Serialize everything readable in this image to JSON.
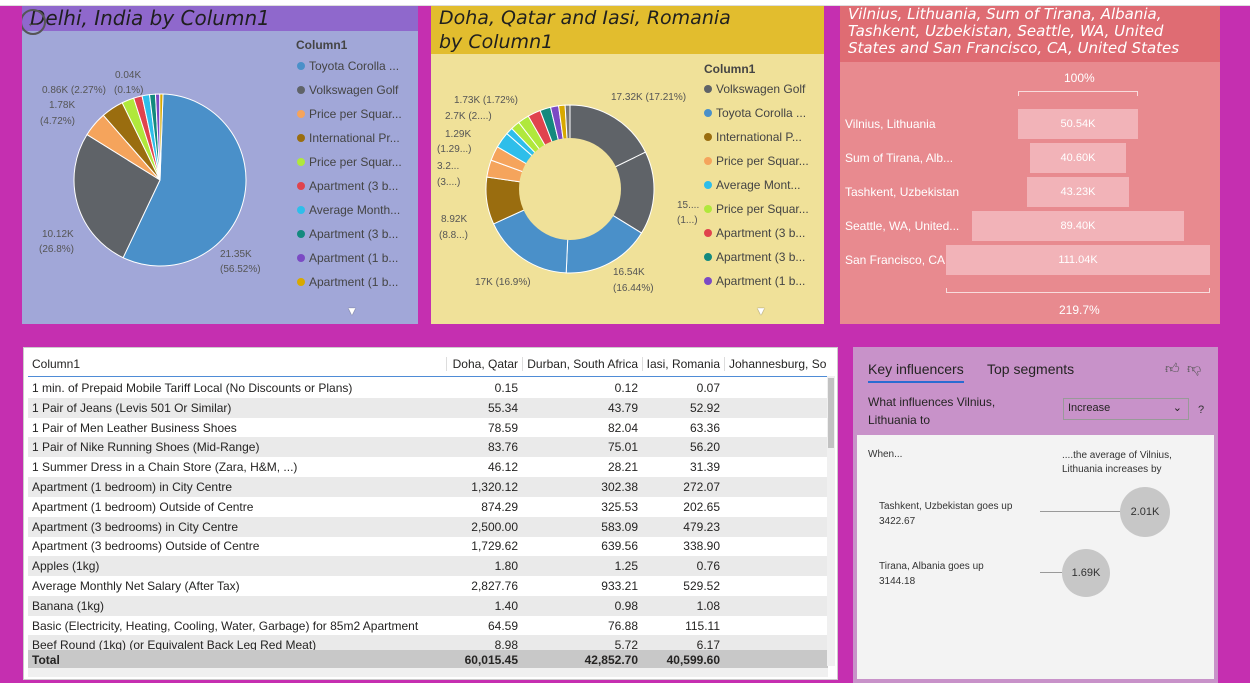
{
  "panel1": {
    "title": "Delhi, India by Column1",
    "legend_title": "Column1",
    "legend": [
      {
        "label": "Toyota Corolla ...",
        "color": "#4a90c9"
      },
      {
        "label": "Volkswagen Golf",
        "color": "#5f6368"
      },
      {
        "label": "Price per Squar...",
        "color": "#f5a45c"
      },
      {
        "label": "International Pr...",
        "color": "#9a6d0f"
      },
      {
        "label": "Price per Squar...",
        "color": "#b0e83c"
      },
      {
        "label": "Apartment (3 b...",
        "color": "#e0434d"
      },
      {
        "label": "Average Month...",
        "color": "#2ebeea"
      },
      {
        "label": "Apartment (3 b...",
        "color": "#138a7e"
      },
      {
        "label": "Apartment (1 b...",
        "color": "#7b4ac4"
      },
      {
        "label": "Apartment (1 b...",
        "color": "#d8a900"
      }
    ],
    "labels": {
      "a": "0.04K",
      "b": "0.86K (2.27%)",
      "c": "(0.1%)",
      "d": "1.78K",
      "e": "(4.72%)",
      "f": "10.12K",
      "g": "(26.8%)",
      "h": "21.35K",
      "i": "(56.52%)"
    }
  },
  "panel2": {
    "title": "Doha, Qatar and Iasi, Romania by Column1",
    "legend_title": "Column1",
    "legend": [
      {
        "label": "Volkswagen Golf",
        "color": "#5f6368"
      },
      {
        "label": "Toyota Corolla ...",
        "color": "#4a90c9"
      },
      {
        "label": "International P...",
        "color": "#9a6d0f"
      },
      {
        "label": "Price per Squar...",
        "color": "#f5a45c"
      },
      {
        "label": "Average Mont...",
        "color": "#2ebeea"
      },
      {
        "label": "Price per Squar...",
        "color": "#b0e83c"
      },
      {
        "label": "Apartment (3 b...",
        "color": "#e0434d"
      },
      {
        "label": "Apartment (3 b...",
        "color": "#138a7e"
      },
      {
        "label": "Apartment (1 b...",
        "color": "#7b4ac4"
      }
    ],
    "labels": {
      "a": "1.73K (1.72%)",
      "b": "2.7K (2....)",
      "c": "1.29K",
      "d": "(1.29...)",
      "e": "3.2...",
      "f": "(3....)",
      "g": "8.92K",
      "h": "(8.8...)",
      "i": "17K (16.9%)",
      "j": "16.54K",
      "k": "(16.44%)",
      "l": "15....",
      "m": "(1...)",
      "n": "17.32K (17.21%)"
    }
  },
  "panel3": {
    "title": "Vilnius, Lithuania, Sum of Tirana, Albania, Tashkent, Uzbekistan, Seattle, WA, United States and San Francisco, CA, United States",
    "top_pct": "100%",
    "bottom_pct": "219.7%",
    "rows": [
      {
        "label": "Vilnius, Lithuania",
        "value": "50.54K"
      },
      {
        "label": "Sum of Tirana, Alb...",
        "value": "40.60K"
      },
      {
        "label": "Tashkent, Uzbekistan",
        "value": "43.23K"
      },
      {
        "label": "Seattle, WA, United...",
        "value": "89.40K"
      },
      {
        "label": "San Francisco, CA, ...",
        "value": "111.04K"
      }
    ]
  },
  "table": {
    "headers": [
      "Column1",
      "Doha, Qatar",
      "Durban, South Africa",
      "Iasi, Romania",
      "Johannesburg, So"
    ],
    "rows": [
      [
        "1 min. of Prepaid Mobile Tariff Local (No Discounts or Plans)",
        "0.15",
        "0.12",
        "0.07"
      ],
      [
        "1 Pair of Jeans (Levis 501 Or Similar)",
        "55.34",
        "43.79",
        "52.92"
      ],
      [
        "1 Pair of Men Leather Business Shoes",
        "78.59",
        "82.04",
        "63.36"
      ],
      [
        "1 Pair of Nike Running Shoes (Mid-Range)",
        "83.76",
        "75.01",
        "56.20"
      ],
      [
        "1 Summer Dress in a Chain Store (Zara, H&M, ...)",
        "46.12",
        "28.21",
        "31.39"
      ],
      [
        "Apartment (1 bedroom) in City Centre",
        "1,320.12",
        "302.38",
        "272.07"
      ],
      [
        "Apartment (1 bedroom) Outside of Centre",
        "874.29",
        "325.53",
        "202.65"
      ],
      [
        "Apartment (3 bedrooms) in City Centre",
        "2,500.00",
        "583.09",
        "479.23"
      ],
      [
        "Apartment (3 bedrooms) Outside of Centre",
        "1,729.62",
        "639.56",
        "338.90"
      ],
      [
        "Apples (1kg)",
        "1.80",
        "1.25",
        "0.76"
      ],
      [
        "Average Monthly Net Salary (After Tax)",
        "2,827.76",
        "933.21",
        "529.52"
      ],
      [
        "Banana (1kg)",
        "1.40",
        "0.98",
        "1.08"
      ],
      [
        "Basic (Electricity, Heating, Cooling, Water, Garbage) for 85m2 Apartment",
        "64.59",
        "76.88",
        "115.11"
      ],
      [
        "Beef Round (1kg) (or Equivalent Back Leg Red Meat)",
        "8.98",
        "5.72",
        "6.17"
      ]
    ],
    "total": [
      "Total",
      "60,015.45",
      "42,852.70",
      "40,599.60"
    ]
  },
  "ki": {
    "tab1": "Key influencers",
    "tab2": "Top segments",
    "question": "What influences Vilnius, Lithuania to",
    "dropdown": "Increase",
    "help": "?",
    "when": "When...",
    "then": "....the average of Vilnius, Lithuania increases by",
    "items": [
      {
        "text": "Tashkent, Uzbekistan goes up 3422.67",
        "value": "2.01K"
      },
      {
        "text": "Tirana, Albania goes up 3144.18",
        "value": "1.69K"
      }
    ]
  }
}
